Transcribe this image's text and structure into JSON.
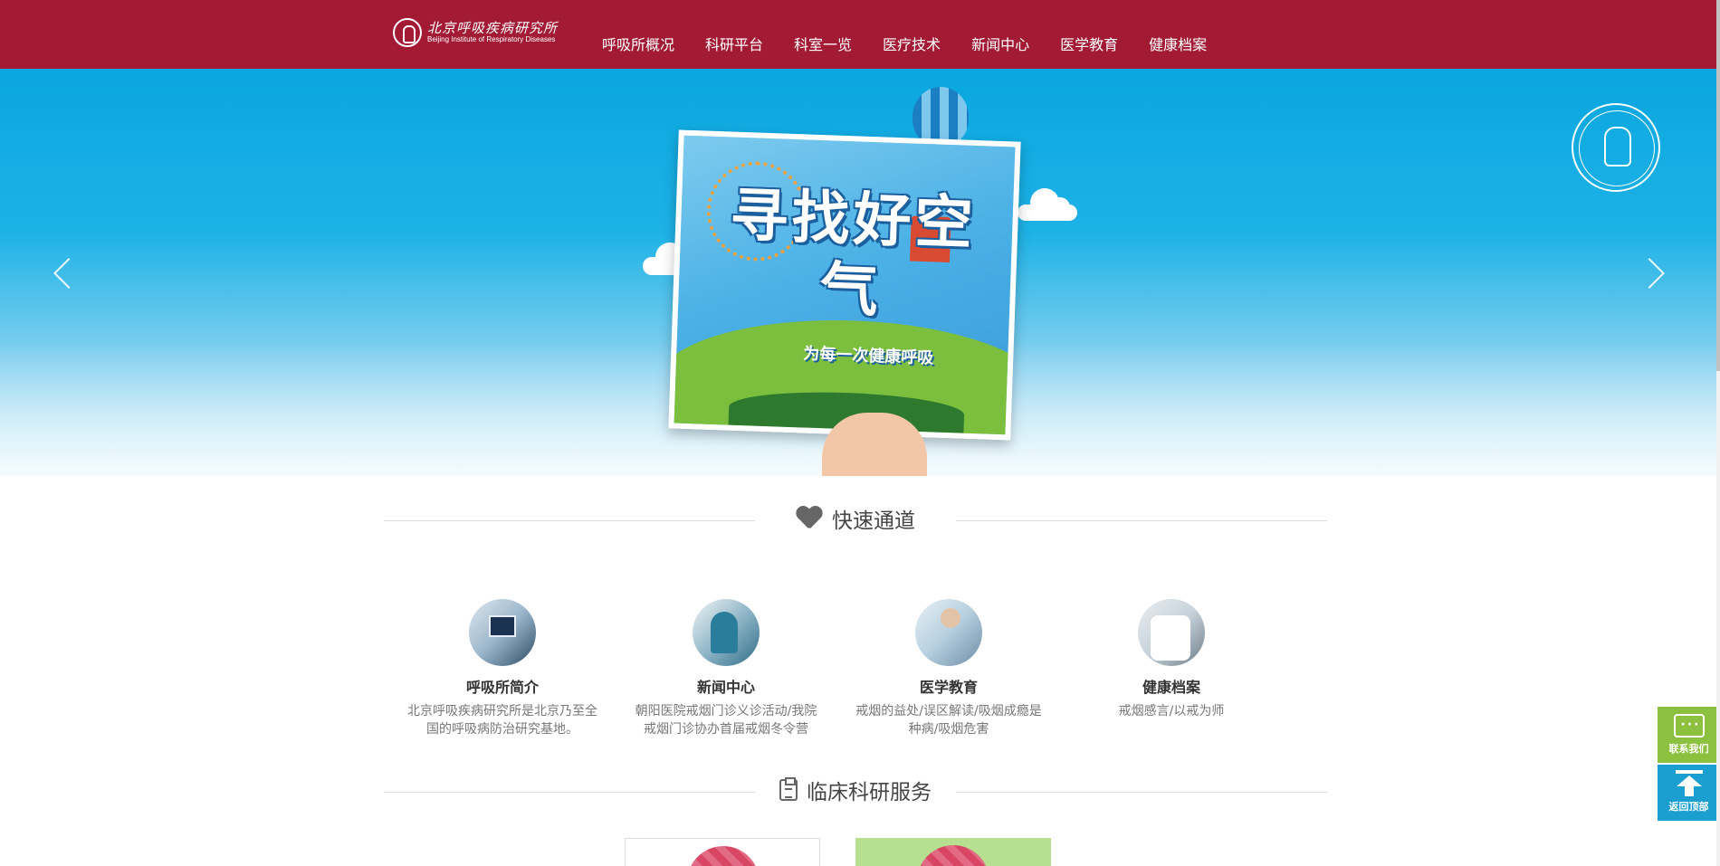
{
  "header": {
    "logo_cn": "北京呼吸疾病研究所",
    "logo_en": "Beijing Institute of Respiratory Diseases",
    "nav": [
      "呼吸所概况",
      "科研平台",
      "科室一览",
      "医疗技术",
      "新闻中心",
      "医学教育",
      "健康档案"
    ]
  },
  "banner": {
    "title": "寻找好空气",
    "subtitle": "为每一次健康呼吸",
    "badge_icon": "institute-seal",
    "prev_icon": "chevron-left-icon",
    "next_icon": "chevron-right-icon"
  },
  "quick_section": {
    "title": "快速通道",
    "icon": "heart-pulse-icon",
    "cards": [
      {
        "title": "呼吸所简介",
        "desc": "北京呼吸疾病研究所是北京乃至全国的呼吸病防治研究基地。"
      },
      {
        "title": "新闻中心",
        "desc": "朝阳医院戒烟门诊义诊活动/我院戒烟门诊协办首届戒烟冬令营"
      },
      {
        "title": "医学教育",
        "desc": "戒烟的益处/误区解读/吸烟成瘾是种病/吸烟危害"
      },
      {
        "title": "健康档案",
        "desc": "戒烟感言/以戒为师"
      }
    ]
  },
  "clinical_section": {
    "title": "临床科研服务",
    "icon": "clipboard-icon"
  },
  "side": {
    "contact_label": "联系我们",
    "top_label": "返回顶部"
  },
  "colors": {
    "brand": "#a21a34",
    "sky": "#0aa6df",
    "contact_green": "#8cc13f",
    "top_blue": "#1a9fd0"
  }
}
